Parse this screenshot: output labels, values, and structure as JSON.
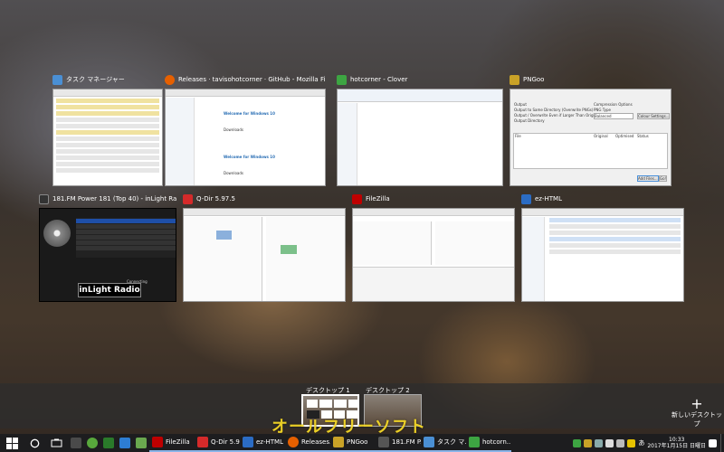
{
  "windows": [
    {
      "title": "タスク マネージャー",
      "icon": "task-manager-icon",
      "color": "#4a8fd4"
    },
    {
      "title": "Releases · tavisohotcorner · GitHub - Mozilla Firefox",
      "icon": "firefox-icon",
      "color": "#e66000"
    },
    {
      "title": "hotcorner - Clover",
      "icon": "clover-icon",
      "color": "#3da542"
    },
    {
      "title": "PNGoo",
      "icon": "pngoo-icon",
      "color": "#c9a227"
    },
    {
      "title": "181.FM Power 181 (Top 40) - inLight Radio Playe...",
      "icon": "inlight-radio-icon",
      "color": "#333333"
    },
    {
      "title": "Q-Dir 5.97.5",
      "icon": "qdir-icon",
      "color": "#d42a2a"
    },
    {
      "title": "FileZilla",
      "icon": "filezilla-icon",
      "color": "#bf0000"
    },
    {
      "title": "ez-HTML",
      "icon": "ez-html-icon",
      "color": "#2b6cc4"
    }
  ],
  "firefox_content": {
    "headline1": "Welcome for Windows 10",
    "downloads1": "Downloads",
    "headline2": "Welcome for Windows 10",
    "downloads2": "Downloads"
  },
  "pngoo_content": {
    "output": "Output",
    "option1": "Output to Same Directory (Overwrite PNGs)",
    "option2": "Output / Overwrite Even if Larger Than Original",
    "output_dir": "Output Directory",
    "compression": "Compression Options",
    "png_type": "PNG Type",
    "balanced": "Balanced",
    "colour_settings": "Colour Settings...",
    "file_col": "File",
    "original_col": "Original",
    "optimised_col": "Optimised",
    "status_col": "Status",
    "add_files": "Add Files...",
    "go": "Go!"
  },
  "radio_content": {
    "logo": "inLight Radio",
    "connecting": "Connecting"
  },
  "desktops": [
    {
      "label": "デスクトップ 1",
      "active": true
    },
    {
      "label": "デスクトップ 2",
      "active": false
    }
  ],
  "new_desktop": {
    "plus": "+",
    "label": "新しいデスクトップ"
  },
  "watermark": "オールフリーソフト",
  "taskbar": {
    "items": [
      {
        "label": "FileZilla",
        "icon": "filezilla-icon",
        "color": "#bf0000"
      },
      {
        "label": "Q-Dir 5.9...",
        "icon": "qdir-icon",
        "color": "#d42a2a"
      },
      {
        "label": "ez-HTML",
        "icon": "ez-html-icon",
        "color": "#2b6cc4"
      },
      {
        "label": "Releases...",
        "icon": "firefox-icon",
        "color": "#e66000"
      },
      {
        "label": "PNGoo",
        "icon": "pngoo-icon",
        "color": "#c9a227"
      },
      {
        "label": "181.FM P...",
        "icon": "inlight-radio-icon",
        "color": "#555555"
      },
      {
        "label": "タスク マ...",
        "icon": "task-manager-icon",
        "color": "#4a8fd4"
      },
      {
        "label": "hotcorn...",
        "icon": "clover-icon",
        "color": "#3da542"
      }
    ],
    "ime": "あ",
    "time": "10:33",
    "date": "2017年1月15日 日曜日"
  }
}
